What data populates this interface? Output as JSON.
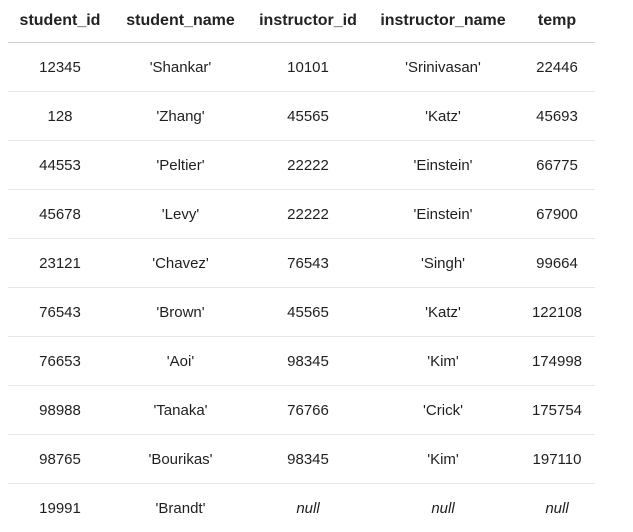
{
  "table": {
    "columns": [
      "student_id",
      "student_name",
      "instructor_id",
      "instructor_name",
      "temp"
    ],
    "rows": [
      [
        "12345",
        "'Shankar'",
        "10101",
        "'Srinivasan'",
        "22446"
      ],
      [
        "128",
        "'Zhang'",
        "45565",
        "'Katz'",
        "45693"
      ],
      [
        "44553",
        "'Peltier'",
        "22222",
        "'Einstein'",
        "66775"
      ],
      [
        "45678",
        "'Levy'",
        "22222",
        "'Einstein'",
        "67900"
      ],
      [
        "23121",
        "'Chavez'",
        "76543",
        "'Singh'",
        "99664"
      ],
      [
        "76543",
        "'Brown'",
        "45565",
        "'Katz'",
        "122108"
      ],
      [
        "76653",
        "'Aoi'",
        "98345",
        "'Kim'",
        "174998"
      ],
      [
        "98988",
        "'Tanaka'",
        "76766",
        "'Crick'",
        "175754"
      ],
      [
        "98765",
        "'Bourikas'",
        "98345",
        "'Kim'",
        "197110"
      ],
      [
        "19991",
        "'Brandt'",
        "null",
        "null",
        "null"
      ]
    ]
  }
}
